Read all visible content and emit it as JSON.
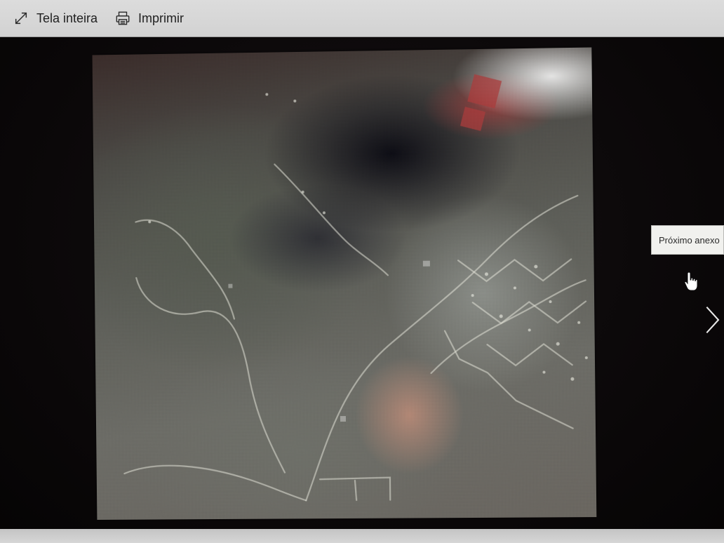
{
  "toolbar": {
    "fullscreen": {
      "label": "Tela inteira",
      "icon": "expand-diagonal-icon"
    },
    "print": {
      "label": "Imprimir",
      "icon": "printer-icon"
    }
  },
  "viewer": {
    "image_description_icon": "aerial-photo",
    "next_tooltip": "Próximo anexo",
    "next_icon": "chevron-right-icon",
    "cursor_icon": "hand-pointer-icon"
  },
  "colors": {
    "toolbar_bg": "#d6d6d6",
    "stage_bg": "#0b090a",
    "tooltip_bg": "#f1f1ee"
  }
}
